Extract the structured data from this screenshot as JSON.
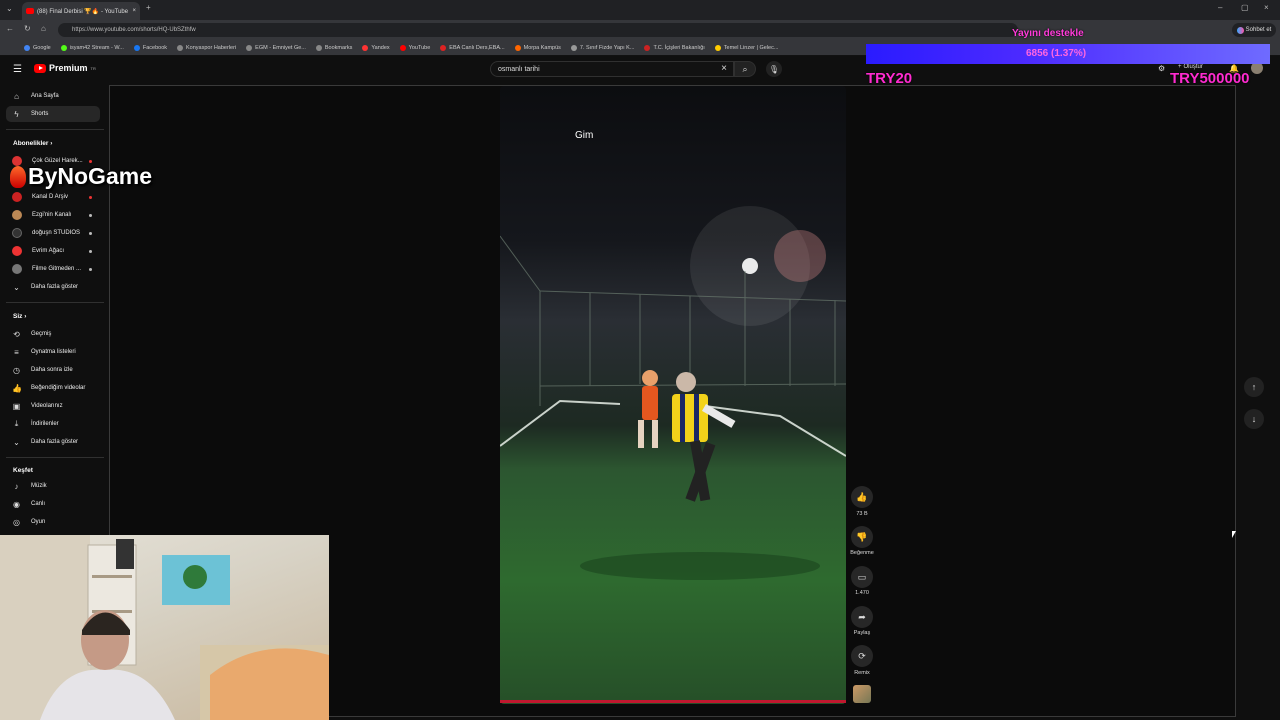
{
  "browser": {
    "tab_title": "(88) Final Derbisi 🏆🔥 - YouTube",
    "url": "https://www.youtube.com/shorts/HQ-UbSZthfw",
    "bookmarks": [
      "Google",
      "isyam42 Stream - W...",
      "Facebook",
      "Konyaspor Haberleri",
      "EGM - Emniyet Ge...",
      "Bookmarks",
      "Yandex",
      "YouTube",
      "EBA Canlı Ders,EBA...",
      "Morpa Kampüs",
      "7. Sınıf Fizde Yapı K...",
      "T.C. İçişleri Bakanlığı",
      "Temel Linzer | Gelec..."
    ],
    "chat_label": "Sohbet et"
  },
  "youtube": {
    "logo_text": "Premium",
    "logo_badge": "TR",
    "search_value": "osmanlı tarihi",
    "create_label": "Oluştur",
    "sidebar": {
      "main": [
        {
          "label": "Ana Sayfa",
          "icon": "home-icon"
        },
        {
          "label": "Shorts",
          "icon": "shorts-icon"
        }
      ],
      "subs_header": "Abonelikler",
      "subscriptions": [
        {
          "label": "Çok Güzel Harek...",
          "color": "#d33"
        },
        {
          "label": "Kanal D Arşiv",
          "color": "#c22"
        },
        {
          "label": "Ezgi'nin Kanalı",
          "color": "#b85"
        },
        {
          "label": "doğuşn STUDIOS",
          "color": "#333"
        },
        {
          "label": "Evrim Ağacı",
          "color": "#e33"
        },
        {
          "label": "Filme Gitmeden ...",
          "color": "#777"
        }
      ],
      "subs_more": "Daha fazla göster",
      "you_header": "Siz",
      "you_items": [
        {
          "label": "Geçmiş",
          "icon": "history-icon"
        },
        {
          "label": "Oynatma listeleri",
          "icon": "playlists-icon"
        },
        {
          "label": "Daha sonra izle",
          "icon": "watch-later-icon"
        },
        {
          "label": "Beğendiğim videolar",
          "icon": "liked-videos-icon"
        },
        {
          "label": "Videolarınız",
          "icon": "your-videos-icon"
        },
        {
          "label": "İndirilenler",
          "icon": "downloads-icon"
        }
      ],
      "you_more": "Daha fazla göster",
      "explore_header": "Keşfet",
      "explore_items": [
        {
          "label": "Müzik",
          "icon": "music-icon"
        },
        {
          "label": "Canlı",
          "icon": "live-icon"
        },
        {
          "label": "Oyun",
          "icon": "gaming-icon"
        }
      ]
    },
    "short": {
      "caption": "Gim",
      "like_count": "73 B",
      "dislike_label": "Beğenme",
      "comment_count": "1.470",
      "share_label": "Paylaş",
      "remix_label": "Remix"
    }
  },
  "overlay": {
    "donate_title": "Yayını destekle",
    "donate_amount": "6856 (1.37%)",
    "goal_left": "TRY20",
    "goal_right": "TRY500000",
    "watermark": "ByNoGame"
  },
  "colors": {
    "accent": "#ff0000",
    "overlay_pink": "#ff2bd0",
    "overlay_bar": "#3a22ff"
  }
}
